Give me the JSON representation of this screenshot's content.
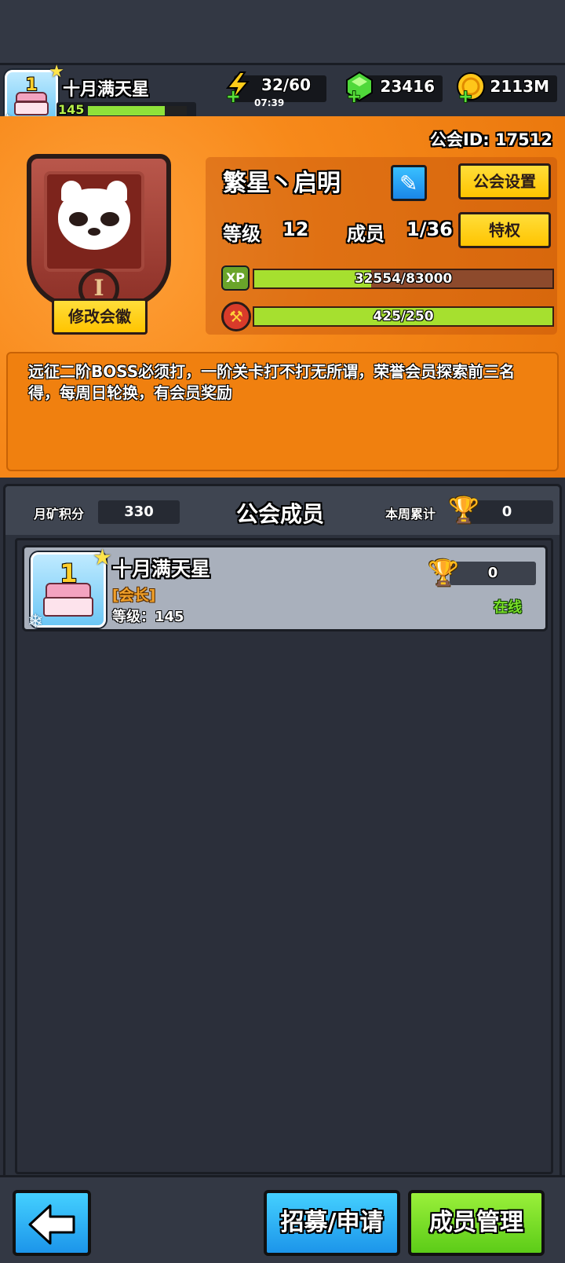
{
  "player": {
    "name": "十月满天星",
    "level": "145",
    "xp_fraction": 0.78
  },
  "resources": {
    "energy": "32/60",
    "energy_timer": "07:39",
    "gems": "23416",
    "coins": "2113M"
  },
  "guild": {
    "id_label": "公会ID: 17512",
    "name": "繁星丶启明",
    "level_label": "等级",
    "level_value": "12",
    "members_label": "成员",
    "members_value": "1/36",
    "settings_button": "公会设置",
    "privilege_button": "特权",
    "edit_emblem_button": "修改会徽",
    "emblem_rank": "I",
    "xp_icon_text": "XP",
    "xp_text": "32554/83000",
    "xp_fraction": 0.392,
    "emblem_bar_text": "425/250",
    "emblem_bar_fraction": 1.0,
    "announcement": "远征二阶BOSS必须打，一阶关卡打不打无所谓，荣誉会员探索前三名得，每周日轮换，有会员奖励"
  },
  "members": {
    "title": "公会成员",
    "monthly_label": "月矿积分",
    "monthly_value": "330",
    "weekly_label": "本周累计",
    "weekly_value": "0",
    "list": [
      {
        "name": "十月满天星",
        "role": "[会长]",
        "level": "等级：145",
        "score": "0",
        "status": "在线"
      }
    ]
  },
  "bottom": {
    "recruit_button": "招募/申请",
    "manage_button": "成员管理"
  },
  "colors": {
    "panel_orange": "#f7891a",
    "accent_yellow": "#ffc400",
    "online_green": "#7be02a",
    "role_orange": "#f2a12a"
  }
}
